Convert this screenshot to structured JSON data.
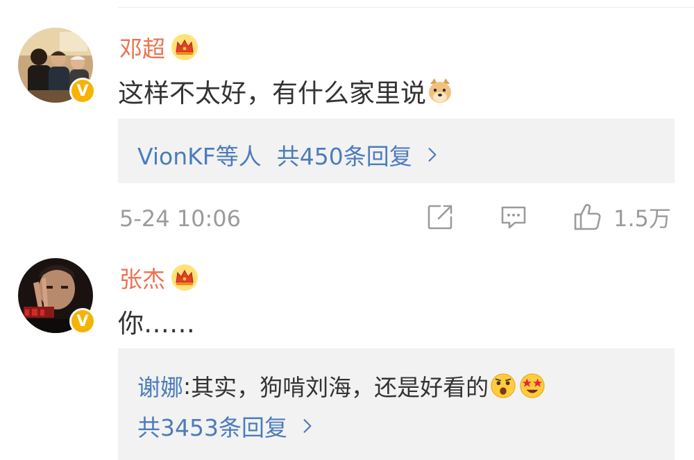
{
  "comments": [
    {
      "username": "邓超",
      "text": "这样不太好，有什么家里说",
      "reply_summary": {
        "users": "VionKF等人",
        "count": "共450条回复"
      },
      "time": "5-24 10:06",
      "likes": "1.5万"
    },
    {
      "username": "张杰",
      "text": "你……",
      "reply_preview": {
        "author": "谢娜",
        "separator": ": ",
        "text": "其实，狗啃刘海，还是好看的"
      },
      "reply_count": "共3453条回复"
    }
  ],
  "colors": {
    "username": "#eb7350",
    "link": "#4b7cbd",
    "muted": "#9b9b9b",
    "reply_bg": "#f2f2f2",
    "vip_badge": "#f6b300"
  },
  "icons": [
    "crown-icon",
    "verified-badge-icon",
    "doge-emoji",
    "share-icon",
    "comment-icon",
    "like-icon",
    "chevron-right-icon",
    "shocked-emoji",
    "star-eyes-emoji"
  ]
}
